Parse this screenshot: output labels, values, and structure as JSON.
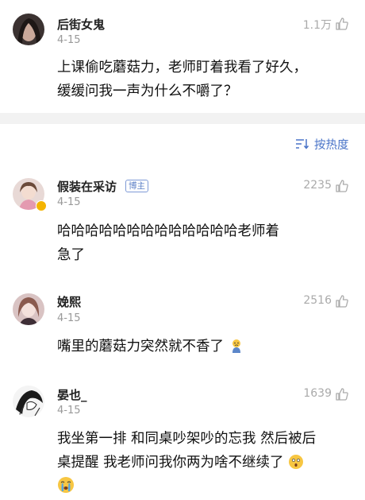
{
  "post": {
    "author": "后街女鬼",
    "date": "4-15",
    "likes": "1.1万",
    "lines": [
      "上课偷吃蘑菇力，老师盯着我看了好久，",
      "缓缓问我一声为什么不嚼了？"
    ]
  },
  "sort": {
    "label": "按热度",
    "icon": "sort-icon"
  },
  "comments": [
    {
      "author": "假装在采访",
      "badge": "博主",
      "date": "4-15",
      "likes": "2235",
      "lines": [
        "哈哈哈哈哈哈哈哈哈哈哈哈哈老师着",
        "急了"
      ]
    },
    {
      "author": "娩熙",
      "date": "4-15",
      "likes": "2516",
      "lines": [
        "嘴里的蘑菇力突然就不香了"
      ],
      "trailing_emoji": "sad-face-emoji"
    },
    {
      "author": "晏也_",
      "date": "4-15",
      "likes": "1639",
      "lines": [
        "我坐第一排 和同桌吵架吵的忘我 然后被后",
        "桌提醒 我老师问我你两为啥不继续了"
      ],
      "trailing_emoji": "surprised-face-emoji",
      "extra_emoji": "crying-face-emoji"
    }
  ],
  "colors": {
    "accent": "#4a74c8",
    "muted": "#999999",
    "divider": "#f2f2f2"
  }
}
